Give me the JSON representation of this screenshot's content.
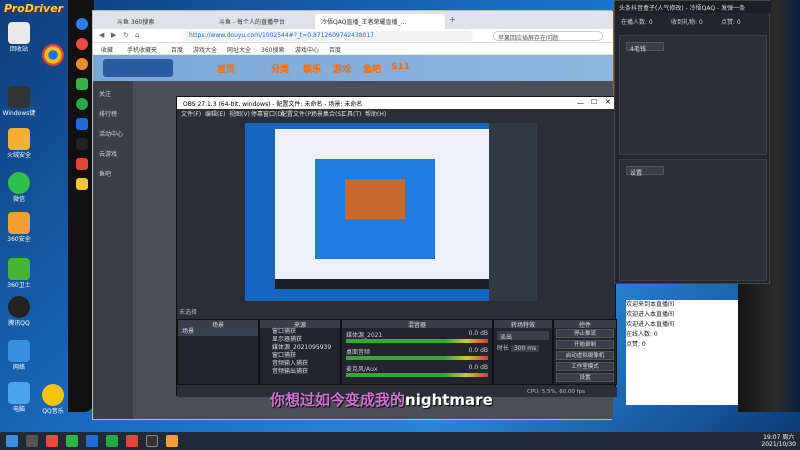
{
  "overlay": {
    "brand": "ProDriver"
  },
  "desktop": {
    "icons": [
      {
        "label": "回收站"
      },
      {
        "label": "Windows键"
      },
      {
        "label": "火绒安全"
      },
      {
        "label": "微信"
      },
      {
        "label": "360安全"
      },
      {
        "label": "360卫士"
      },
      {
        "label": "QQ音乐"
      },
      {
        "label": "腾讯QQ"
      },
      {
        "label": "网络"
      },
      {
        "label": "电脑"
      }
    ]
  },
  "browser": {
    "tabs": [
      {
        "label": "斗鱼 360搜索"
      },
      {
        "label": "斗鱼 - 每个人的直播平台"
      },
      {
        "label": "冷悟QAQ直播_王者荣耀直播_..."
      }
    ],
    "url": "https://www.douyu.com/1002544#?_t=0.8712609742438017",
    "search_placeholder": "苹果回应插屏存在问题",
    "bookmarks": [
      "收藏",
      "手机收藏夹",
      "百度",
      "游戏大全",
      "网址大全",
      "360搜索",
      "游戏中心",
      "百度"
    ],
    "site_nav": [
      "首页",
      "分类",
      "娱乐",
      "游戏",
      "鱼吧",
      "S11"
    ]
  },
  "douyu_sidebar": [
    "关注",
    "排行榜",
    "活动中心",
    "云游戏",
    "鱼吧"
  ],
  "obs": {
    "title": "OBS 27.1.3 (64-bit, windows) - 配置文件: 未命名 - 场景: 未命名",
    "menu": [
      "文件(F)",
      "编辑(E)",
      "视图(V)",
      "停靠窗口(D)",
      "配置文件(P)",
      "场景集合(S)",
      "工具(T)",
      "帮助(H)"
    ],
    "status_selected": "未选择",
    "docks": {
      "scenes": "场景",
      "sources": "来源",
      "mixer": "混音器",
      "transitions": "转场特效",
      "controls": "控件"
    },
    "scene_item": "场景",
    "sources": [
      "窗口捕获",
      "显示器捕获",
      "媒体源_2021095939",
      "窗口捕获",
      "音频输入捕获",
      "音频输出捕获"
    ],
    "mixer": [
      {
        "name": "媒体源_2021",
        "db": "0.0 dB"
      },
      {
        "name": "桌面音频",
        "db": "0.0 dB"
      },
      {
        "name": "麦克风/Aux",
        "db": "0.0 dB"
      }
    ],
    "transition": {
      "type": "淡出",
      "duration_label": "时长",
      "duration": "300 ms"
    },
    "controls": [
      "停止推流",
      "开始录制",
      "启动虚拟摄像机",
      "工作室模式",
      "设置",
      "退出"
    ],
    "statusbar": "CPU: 5.5%, 60.00 fps"
  },
  "tool_window": {
    "title": "头条抖音盒子(人气修改) - 冷悟QAQ - 发弹一条",
    "stats": [
      "在播人数: 0",
      "收到礼物: 0",
      "点赞: 0"
    ],
    "select1": "4毛钱",
    "select2": "设置"
  },
  "chat": {
    "lines": [
      "欢迎来到本直播间",
      "欢迎进入本直播间",
      "欢迎进入本直播间",
      "在线人数: 0",
      "点赞: 0"
    ]
  },
  "subtitle": {
    "main": "你想过如今变成我的",
    "tail": "nightmare"
  },
  "taskbar": {
    "time": "19:07 周六",
    "date": "2021/10/30"
  }
}
